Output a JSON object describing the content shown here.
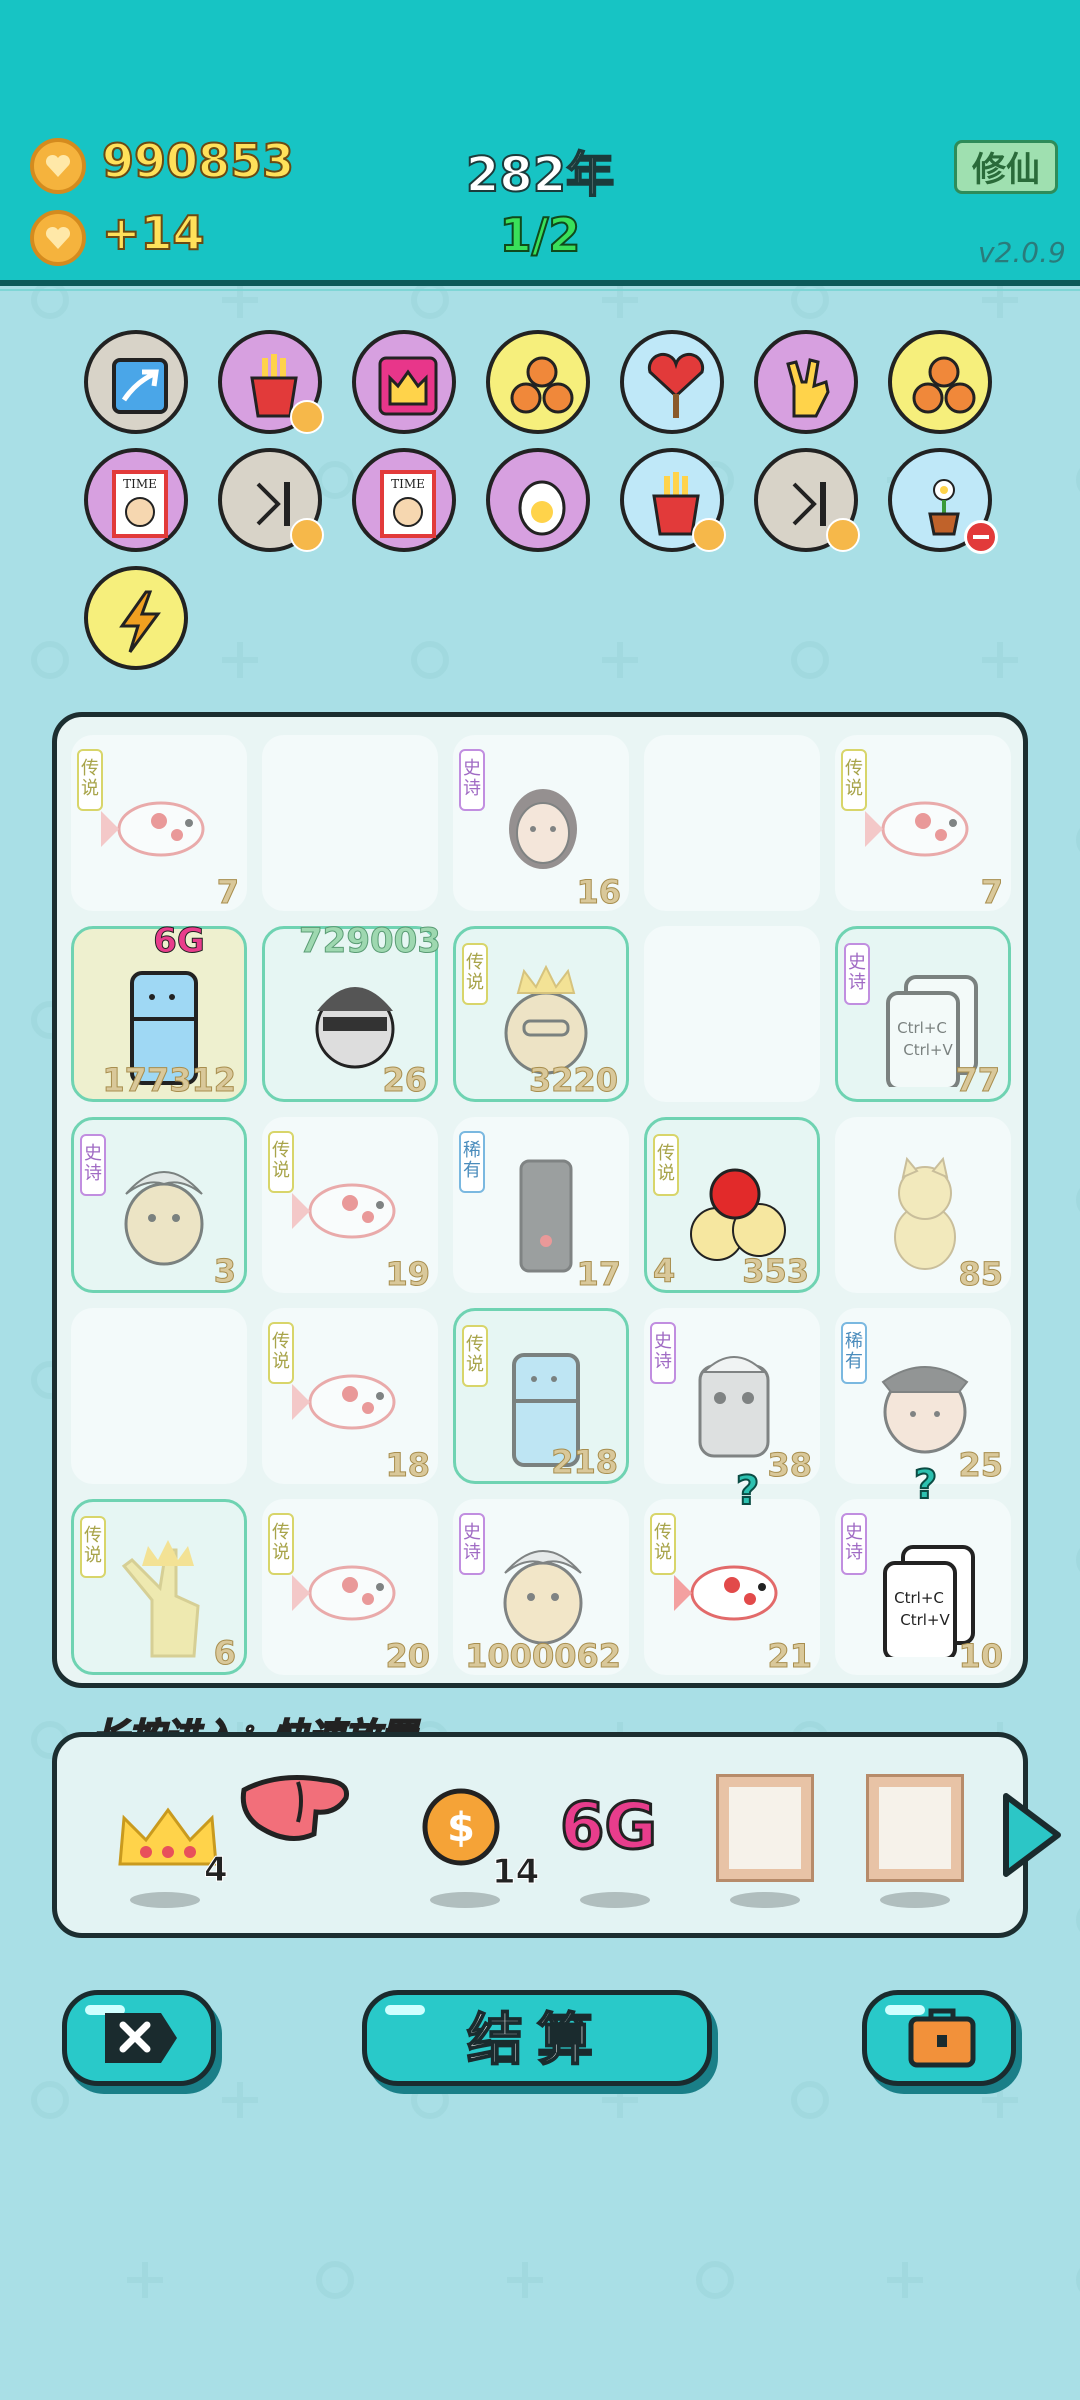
{
  "header": {
    "coins": "990853",
    "income": "+14",
    "year": "282年",
    "progress": "1/2",
    "mode_button": "修仙",
    "version": "v2.0.9"
  },
  "item_bar": {
    "items": [
      {
        "name": "speed-up-arrow",
        "bg": "#d8d3c8"
      },
      {
        "name": "french-fries",
        "bg": "#d7a0e0"
      },
      {
        "name": "pink-robot-item",
        "bg": "#d7a0e0"
      },
      {
        "name": "three-basketballs",
        "bg": "#f6ef7c"
      },
      {
        "name": "heart-fan",
        "bg": "#bfe8f8"
      },
      {
        "name": "rock-hand",
        "bg": "#d7a0e0"
      },
      {
        "name": "three-basketballs-2",
        "bg": "#f6ef7c"
      },
      {
        "name": "time-magazine",
        "bg": "#d7a0e0"
      },
      {
        "name": "skip-next",
        "bg": "#d8d3c8"
      },
      {
        "name": "time-magazine-2",
        "bg": "#d7a0e0"
      },
      {
        "name": "egg",
        "bg": "#d7a0e0"
      },
      {
        "name": "french-fries-2",
        "bg": "#bfe8f8"
      },
      {
        "name": "skip-next-2",
        "bg": "#d8d3c8"
      },
      {
        "name": "flower-pot",
        "bg": "#bfe8f8"
      },
      {
        "name": "lightning-bolt",
        "bg": "#f6ef7c"
      }
    ]
  },
  "board": {
    "cells": [
      {
        "tag": "传说",
        "tagtype": "legend",
        "figure": "fish",
        "num": "7"
      },
      {
        "figure": "none"
      },
      {
        "tag": "史诗",
        "tagtype": "epic",
        "figure": "girl",
        "num": "16"
      },
      {
        "figure": "none"
      },
      {
        "tag": "传说",
        "tagtype": "legend",
        "figure": "fish",
        "num": "7"
      },
      {
        "figure": "fridge",
        "num": "177312",
        "top": "6G"
      },
      {
        "figure": "thief",
        "num": "26",
        "top": "729003"
      },
      {
        "tag": "传说",
        "tagtype": "legend",
        "figure": "king",
        "num": "3220"
      },
      {
        "figure": "none"
      },
      {
        "tag": "史诗",
        "tagtype": "epic",
        "figure": "ctrl",
        "num": "77"
      },
      {
        "tag": "史诗",
        "tagtype": "epic",
        "figure": "chick",
        "num": "3"
      },
      {
        "tag": "传说",
        "tagtype": "legend",
        "figure": "fish",
        "num": "19"
      },
      {
        "tag": "稀有",
        "tagtype": "rare",
        "figure": "pc",
        "num": "17"
      },
      {
        "tag": "传说",
        "tagtype": "legend",
        "figure": "balls",
        "num": "353",
        "lnum": "4"
      },
      {
        "figure": "cat",
        "num": "85"
      },
      {
        "figure": "none"
      },
      {
        "tag": "传说",
        "tagtype": "legend",
        "figure": "fish",
        "num": "18"
      },
      {
        "tag": "传说",
        "tagtype": "legend",
        "figure": "fridge",
        "num": "218"
      },
      {
        "tag": "史诗",
        "tagtype": "epic",
        "figure": "robot",
        "num": "38"
      },
      {
        "tag": "稀有",
        "tagtype": "rare",
        "figure": "police",
        "num": "25"
      },
      {
        "tag": "传说",
        "tagtype": "legend",
        "figure": "hand",
        "num": "6"
      },
      {
        "tag": "传说",
        "tagtype": "legend",
        "figure": "fish",
        "num": "20"
      },
      {
        "tag": "史诗",
        "tagtype": "epic",
        "figure": "chick",
        "num": "1000062"
      },
      {
        "tag": "传说",
        "tagtype": "legend",
        "figure": "fish",
        "num": "21"
      },
      {
        "tag": "史诗",
        "tagtype": "epic",
        "figure": "ctrl",
        "num": "10"
      }
    ]
  },
  "inventory": {
    "hint": "长按进入：快速放置",
    "slots": [
      {
        "name": "crown",
        "count": "4"
      },
      {
        "name": "liver",
        "count": ""
      },
      {
        "name": "coin",
        "count": "14"
      },
      {
        "name": "6g",
        "count": "",
        "label": "6G"
      },
      {
        "name": "frame",
        "count": ""
      },
      {
        "name": "frame-2",
        "count": ""
      }
    ]
  },
  "ctrl_text": {
    "line1": "Ctrl+C",
    "line2": "Ctrl+V"
  },
  "buttons": {
    "settle": "结算"
  },
  "colors": {
    "top_bar": "#17c4c4",
    "background": "#a9dfe6",
    "button": "#29c9c9"
  }
}
